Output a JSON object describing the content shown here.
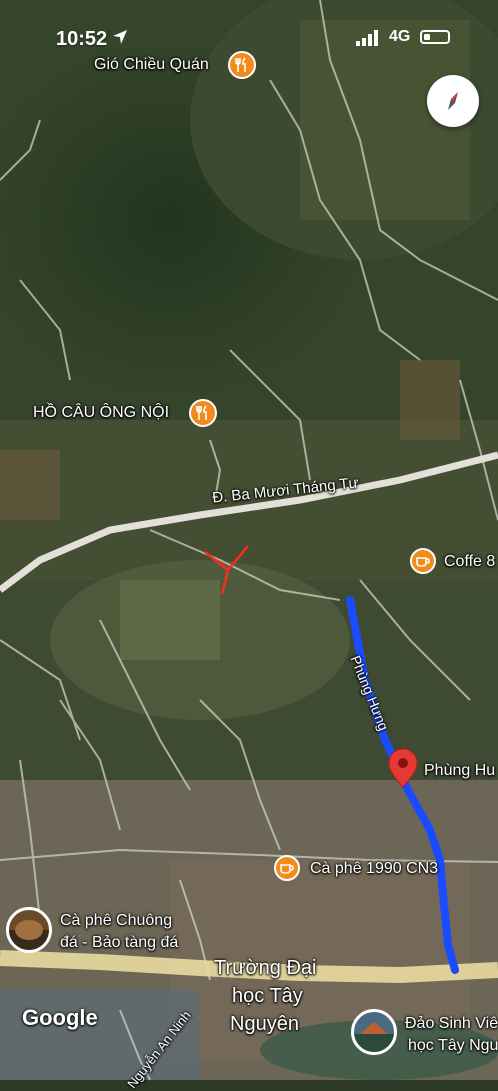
{
  "status_bar": {
    "time": "10:52",
    "network": "4G"
  },
  "map": {
    "places": {
      "gio_chieu_quan": "Gió Chiều Quán",
      "ho_cau": "HỒ CÂU ÔNG NỘI",
      "coffee": "Coffe 8",
      "phung_hung_pin": "Phùng Hu",
      "ca_phe_1990": "Cà phê 1990 CN3",
      "ca_phe_chuong_line1": "Cà phê Chuông",
      "ca_phe_chuong_line2": "đá - Bảo tàng đá",
      "truong_line1": "Trường Đại",
      "truong_line2": "học Tây",
      "truong_line3": "Nguyên",
      "dao_sinh_vien_line1": "Đảo Sinh Viê",
      "dao_sinh_vien_line2": "học Tây Ngu"
    },
    "roads": {
      "ba_muoi_thang_tu": "Đ. Ba Mươi Tháng Tư",
      "phung_hung": "Phùng Hưng",
      "nguyen_an_ninh": "Nguyễn An Ninh"
    },
    "attribution": "Google",
    "route_color": "#1a4cff",
    "marker_color": "#e53935",
    "poi_color": "#f28b1c"
  }
}
